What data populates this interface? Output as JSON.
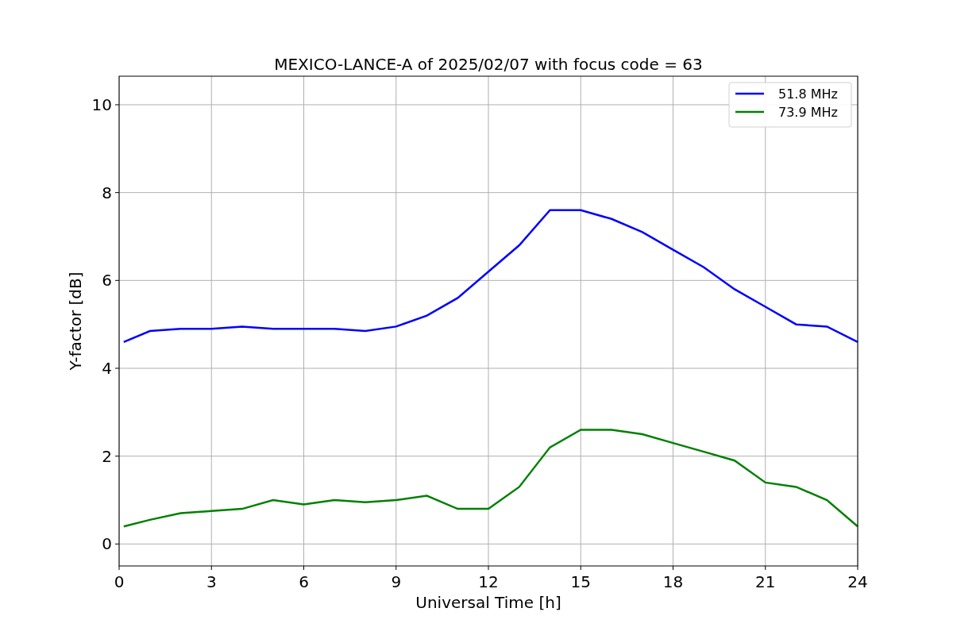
{
  "chart_data": {
    "type": "line",
    "title": "MEXICO-LANCE-A of 2025/02/07 with focus code = 63",
    "xlabel": "Universal Time [h]",
    "ylabel": "Y-factor [dB]",
    "x": [
      0.15,
      1,
      2,
      3,
      4,
      5,
      6,
      7,
      8,
      9,
      10,
      11,
      12,
      13,
      14,
      15,
      16,
      17,
      18,
      19,
      20,
      21,
      22,
      23,
      24
    ],
    "series": [
      {
        "name": "51.8 MHz",
        "color": "#0000ff",
        "values": [
          4.6,
          4.85,
          4.9,
          4.9,
          4.95,
          4.9,
          4.9,
          4.9,
          4.85,
          4.95,
          5.2,
          5.6,
          6.2,
          6.8,
          7.6,
          7.6,
          7.4,
          7.1,
          6.7,
          6.3,
          5.8,
          5.4,
          5.0,
          4.95,
          4.6
        ]
      },
      {
        "name": "73.9 MHz",
        "color": "#008000",
        "values": [
          0.4,
          0.55,
          0.7,
          0.75,
          0.8,
          1.0,
          0.9,
          1.0,
          0.95,
          1.0,
          1.1,
          0.8,
          0.8,
          1.3,
          2.2,
          2.6,
          2.6,
          2.5,
          2.3,
          2.1,
          1.9,
          1.4,
          1.3,
          1.0,
          0.4
        ]
      }
    ],
    "grid": true,
    "legend": true,
    "xlim": [
      0,
      24
    ],
    "ylim": [
      -0.5,
      10.65
    ],
    "xticks": [
      0,
      3,
      6,
      9,
      12,
      15,
      18,
      21,
      24
    ],
    "yticks": [
      0,
      2,
      4,
      6,
      8,
      10
    ]
  }
}
